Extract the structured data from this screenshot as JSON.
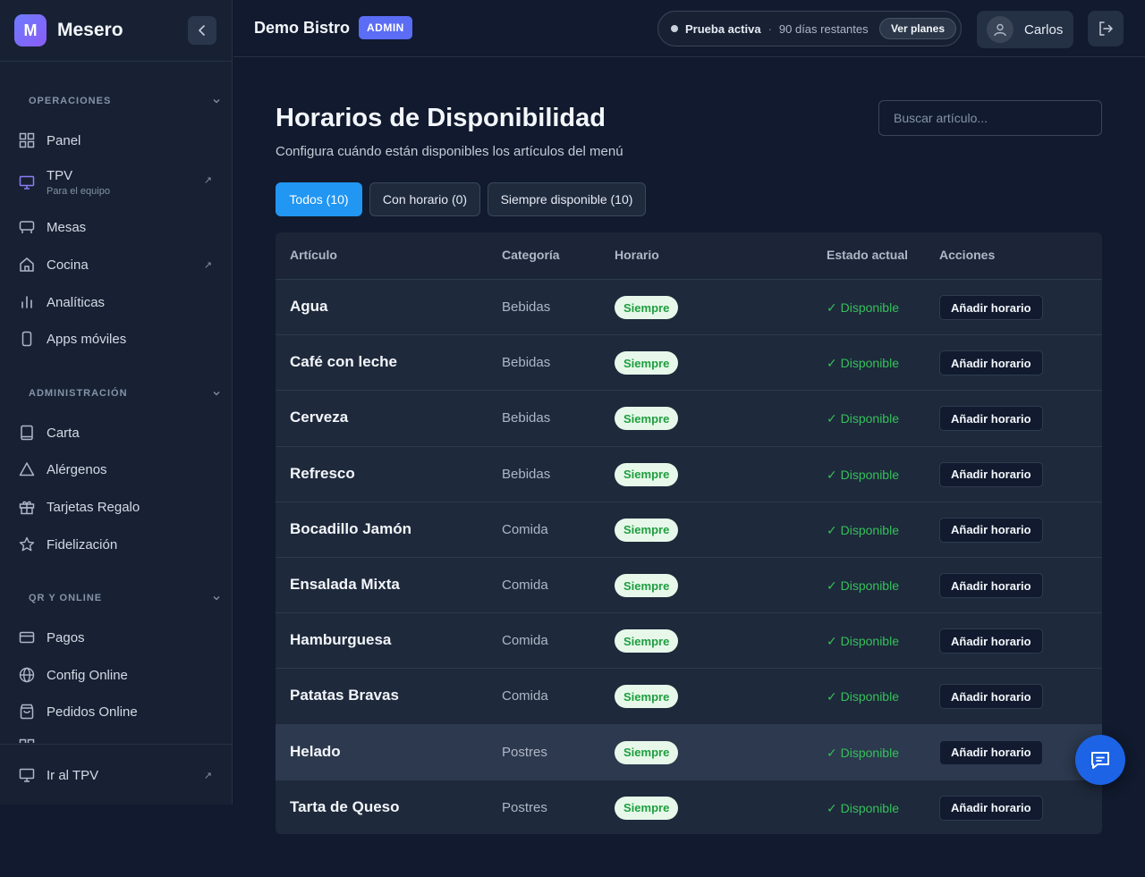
{
  "brand": {
    "logo_letter": "M",
    "name": "Mesero"
  },
  "sidebar": {
    "sections": [
      {
        "title": "OPERACIONES"
      },
      {
        "title": "ADMINISTRACIÓN"
      },
      {
        "title": "QR Y ONLINE"
      }
    ],
    "items": [
      {
        "label": "Panel",
        "icon": "grid-icon"
      },
      {
        "label": "TPV",
        "sub": "Para el equipo",
        "icon": "monitor-icon"
      },
      {
        "label": "Mesas",
        "icon": "table-icon"
      },
      {
        "label": "Cocina",
        "icon": "home-icon"
      },
      {
        "label": "Analíticas",
        "icon": "bar-chart-icon"
      },
      {
        "label": "Apps móviles",
        "icon": "smartphone-icon"
      },
      {
        "label": "Carta",
        "icon": "book-icon"
      },
      {
        "label": "Alérgenos",
        "icon": "warning-icon"
      },
      {
        "label": "Tarjetas Regalo",
        "icon": "gift-icon"
      },
      {
        "label": "Fidelización",
        "icon": "star-icon"
      },
      {
        "label": "Pagos",
        "icon": "credit-card-icon"
      },
      {
        "label": "Config Online",
        "icon": "globe-icon"
      },
      {
        "label": "Pedidos Online",
        "icon": "shopping-bag-icon"
      }
    ],
    "footer": {
      "label": "Ir al TPV",
      "icon": "monitor-icon"
    }
  },
  "header": {
    "org_name": "Demo Bistro",
    "role_badge": "ADMIN",
    "trial": {
      "status": "Prueba activa",
      "separator": "·",
      "remaining": "90 días restantes",
      "plans_label": "Ver planes"
    },
    "user": {
      "name": "Carlos"
    }
  },
  "page": {
    "title": "Horarios de Disponibilidad",
    "subtitle": "Configura cuándo están disponibles los artículos del menú",
    "search_placeholder": "Buscar artículo..."
  },
  "filters": [
    {
      "label": "Todos (10)",
      "active": true
    },
    {
      "label": "Con horario (0)",
      "active": false
    },
    {
      "label": "Siempre disponible (10)",
      "active": false
    }
  ],
  "table": {
    "columns": [
      "Artículo",
      "Categoría",
      "Horario",
      "Estado actual",
      "Acciones"
    ],
    "rows": [
      {
        "name": "Agua",
        "category": "Bebidas",
        "schedule": "Siempre",
        "status": "✓ Disponible",
        "action": "Añadir horario"
      },
      {
        "name": "Café con leche",
        "category": "Bebidas",
        "schedule": "Siempre",
        "status": "✓ Disponible",
        "action": "Añadir horario"
      },
      {
        "name": "Cerveza",
        "category": "Bebidas",
        "schedule": "Siempre",
        "status": "✓ Disponible",
        "action": "Añadir horario"
      },
      {
        "name": "Refresco",
        "category": "Bebidas",
        "schedule": "Siempre",
        "status": "✓ Disponible",
        "action": "Añadir horario"
      },
      {
        "name": "Bocadillo Jamón",
        "category": "Comida",
        "schedule": "Siempre",
        "status": "✓ Disponible",
        "action": "Añadir horario"
      },
      {
        "name": "Ensalada Mixta",
        "category": "Comida",
        "schedule": "Siempre",
        "status": "✓ Disponible",
        "action": "Añadir horario"
      },
      {
        "name": "Hamburguesa",
        "category": "Comida",
        "schedule": "Siempre",
        "status": "✓ Disponible",
        "action": "Añadir horario"
      },
      {
        "name": "Patatas Bravas",
        "category": "Comida",
        "schedule": "Siempre",
        "status": "✓ Disponible",
        "action": "Añadir horario"
      },
      {
        "name": "Helado",
        "category": "Postres",
        "schedule": "Siempre",
        "status": "✓ Disponible",
        "action": "Añadir horario"
      },
      {
        "name": "Tarta de Queso",
        "category": "Postres",
        "schedule": "Siempre",
        "status": "✓ Disponible",
        "action": "Añadir horario"
      }
    ]
  },
  "colors": {
    "accent": "#2196f3",
    "brand": "#6d7cff",
    "success": "#34c05a",
    "background": "#111a2e"
  }
}
